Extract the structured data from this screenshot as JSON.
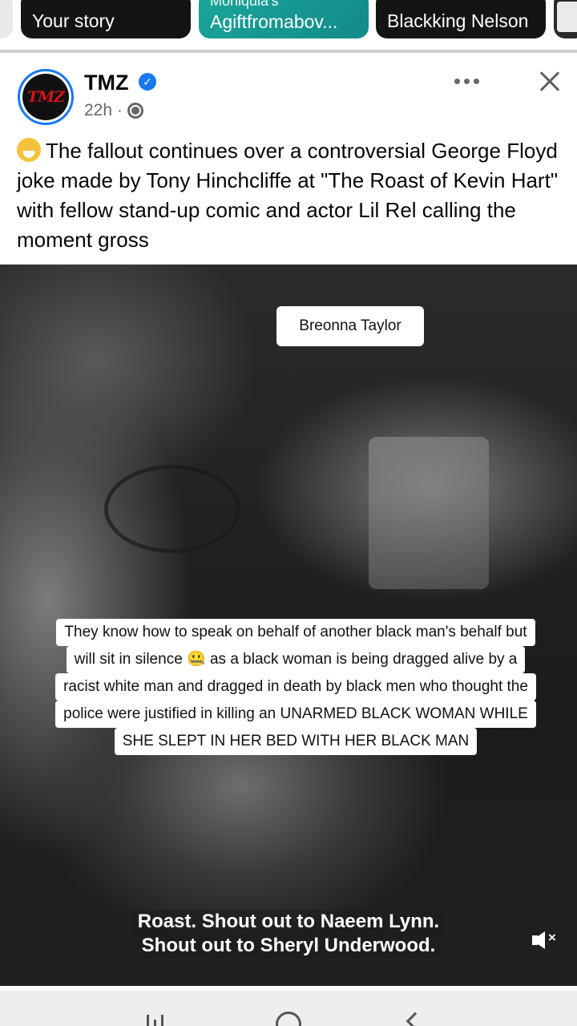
{
  "stories": {
    "items": [
      {
        "label": "Your story"
      },
      {
        "label_top": "Moniquia's",
        "label": "Agiftfromabov..."
      },
      {
        "label": "Blackking Nelson"
      }
    ]
  },
  "post": {
    "page_name": "TMZ",
    "avatar_logo": "TMZ",
    "time": "22h",
    "privacy_separator": "·",
    "caption": "The fallout continues over a controversial George Floyd joke made by Tony Hinchcliffe at \"The Roast of Kevin Hart\" with fellow stand-up comic and actor Lil Rel calling the moment gross"
  },
  "video": {
    "label_box": "Breonna Taylor",
    "overlay_lines": [
      "They know how to speak on behalf of another black man's behalf but",
      "will sit in silence 🤐 as a black woman is being dragged alive by a",
      "racist white man and dragged in death by black men who thought the",
      "police were justified in killing an UNARMED BLACK WOMAN WHILE",
      "SHE SLEPT IN HER BED WITH HER BLACK MAN"
    ],
    "subtitles": [
      "Roast. Shout out to Naeem Lynn.",
      "Shout out to Sheryl Underwood."
    ],
    "mute_icon": "speaker-muted-icon"
  },
  "colors": {
    "accent": "#1877f2",
    "brand_red": "#d8131b",
    "story_teal": "#1aa59a"
  }
}
